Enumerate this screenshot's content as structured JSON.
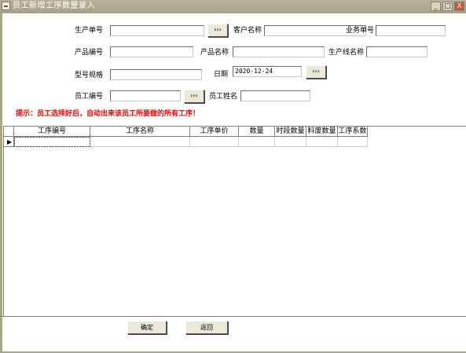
{
  "window": {
    "title": "员工新增工序数量录入",
    "buttons": {
      "minimize": "_",
      "maximize": "□",
      "close": "X"
    }
  },
  "form": {
    "production_no": {
      "label": "生产单号",
      "value": ""
    },
    "customer_name": {
      "label": "客户名称",
      "value": ""
    },
    "business_no": {
      "label": "业务单号",
      "value": ""
    },
    "product_code": {
      "label": "产品编号",
      "value": ""
    },
    "product_name": {
      "label": "产品名称",
      "value": ""
    },
    "line_name": {
      "label": "生产线名称",
      "value": ""
    },
    "model_spec": {
      "label": "型号规格",
      "value": ""
    },
    "date": {
      "label": "日期",
      "value": "2020-12-24"
    },
    "employee_no": {
      "label": "员工编号",
      "value": ""
    },
    "employee_name": {
      "label": "员工姓名",
      "value": ""
    },
    "lookup_button": "›››"
  },
  "hint": "提示：员工选择好后，自动出来该员工所要做的所有工序！",
  "grid": {
    "columns": [
      "工序编号",
      "工序名称",
      "工序单价",
      "数量",
      "时段数量",
      "料废数量",
      "工序系数"
    ],
    "row_indicator": "▶"
  },
  "actions": {
    "confirm": "确定",
    "back": "返回"
  }
}
